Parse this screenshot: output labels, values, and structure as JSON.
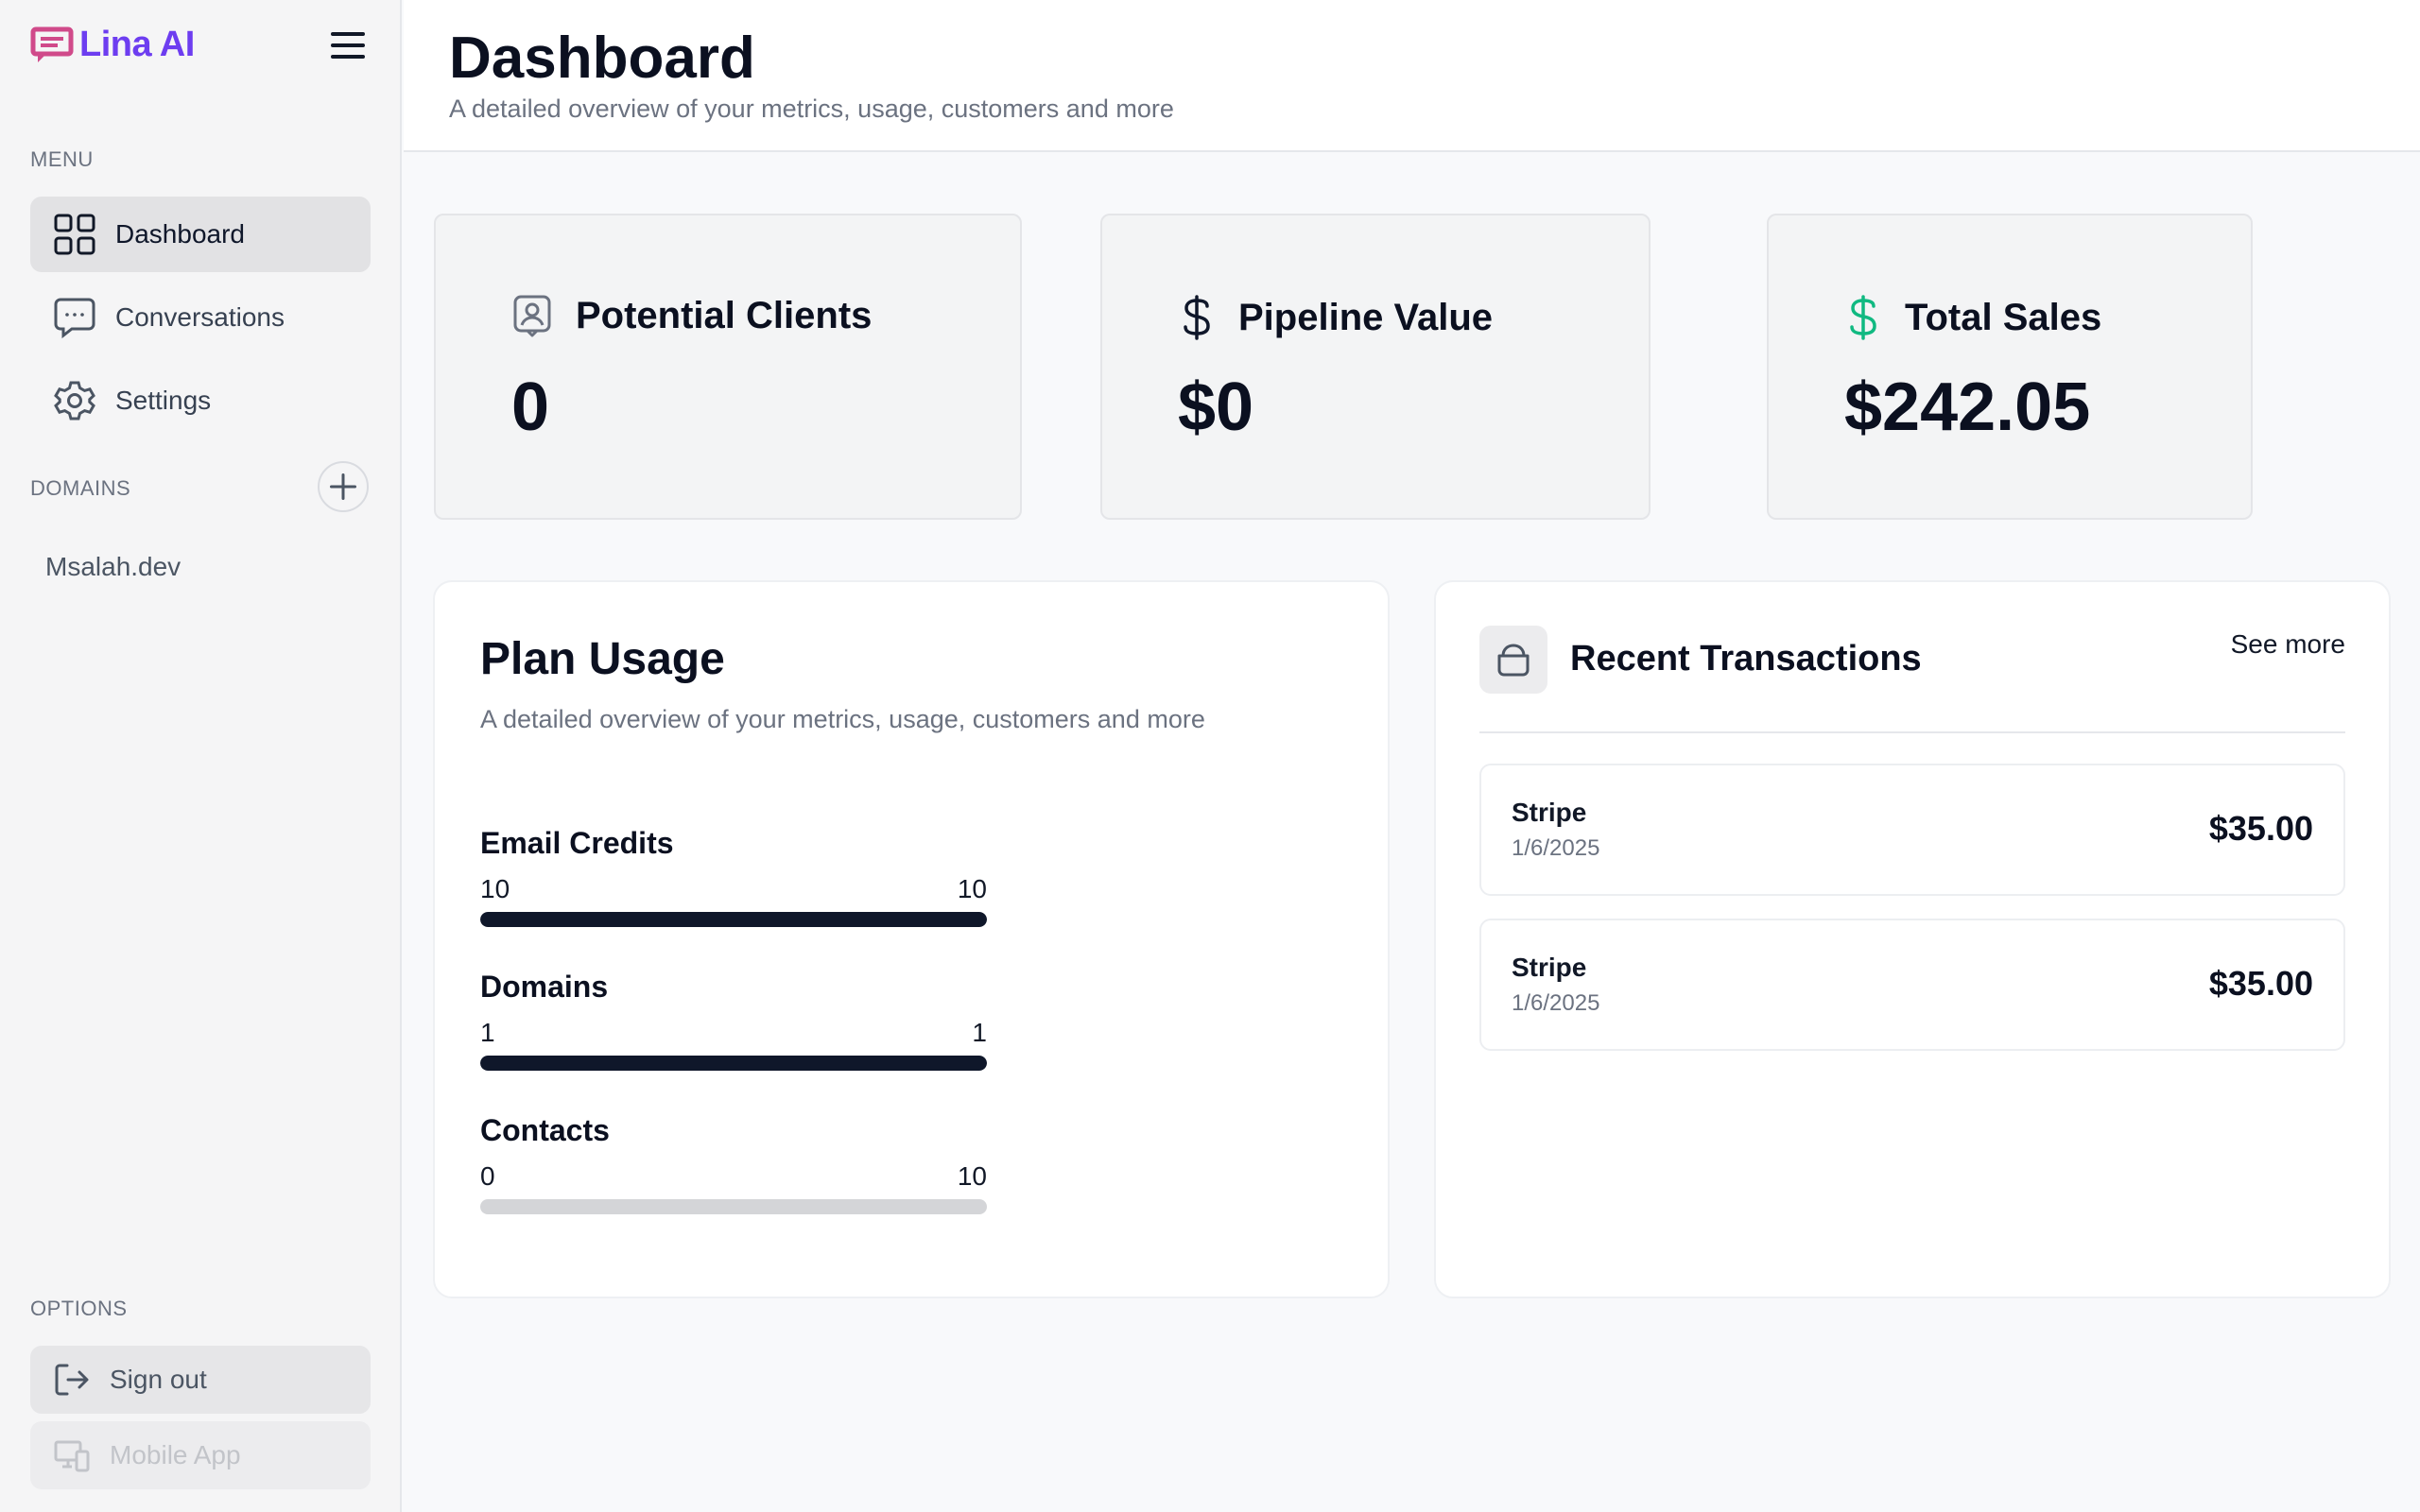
{
  "brand": {
    "name": "Lina AI",
    "accent": "#6d3df0",
    "logo_color": "#d04a8a"
  },
  "sidebar": {
    "menu_label": "MENU",
    "items": [
      {
        "label": "Dashboard",
        "icon": "dashboard-grid-icon",
        "active": true
      },
      {
        "label": "Conversations",
        "icon": "chat-bubble-icon",
        "active": false
      },
      {
        "label": "Settings",
        "icon": "gear-icon",
        "active": false
      }
    ],
    "domains_label": "DOMAINS",
    "domains": [
      {
        "label": "Msalah.dev"
      }
    ],
    "options_label": "OPTIONS",
    "sign_out_label": "Sign out",
    "mobile_app_label": "Mobile App"
  },
  "header": {
    "title": "Dashboard",
    "subtitle": "A detailed overview of your metrics, usage, customers and more"
  },
  "stats": [
    {
      "label": "Potential Clients",
      "value": "0",
      "icon": "person-badge-icon"
    },
    {
      "label": "Pipeline Value",
      "value": "$0",
      "icon": "dollar-icon"
    },
    {
      "label": "Total Sales",
      "value": "$242.05",
      "icon": "dollar-green-icon",
      "icon_color": "#10b981"
    }
  ],
  "plan_usage": {
    "title": "Plan Usage",
    "subtitle": "A detailed overview of your metrics, usage, customers and more",
    "items": [
      {
        "label": "Email Credits",
        "used": "10",
        "limit": "10",
        "fraction": 1.0
      },
      {
        "label": "Domains",
        "used": "1",
        "limit": "1",
        "fraction": 1.0
      },
      {
        "label": "Contacts",
        "used": "0",
        "limit": "10",
        "fraction": 0.0
      }
    ]
  },
  "transactions": {
    "title": "Recent Transactions",
    "see_more": "See more",
    "icon": "shopping-bag-icon",
    "rows": [
      {
        "name": "Stripe",
        "date": "1/6/2025",
        "amount": "$35.00"
      },
      {
        "name": "Stripe",
        "date": "1/6/2025",
        "amount": "$35.00"
      }
    ]
  }
}
